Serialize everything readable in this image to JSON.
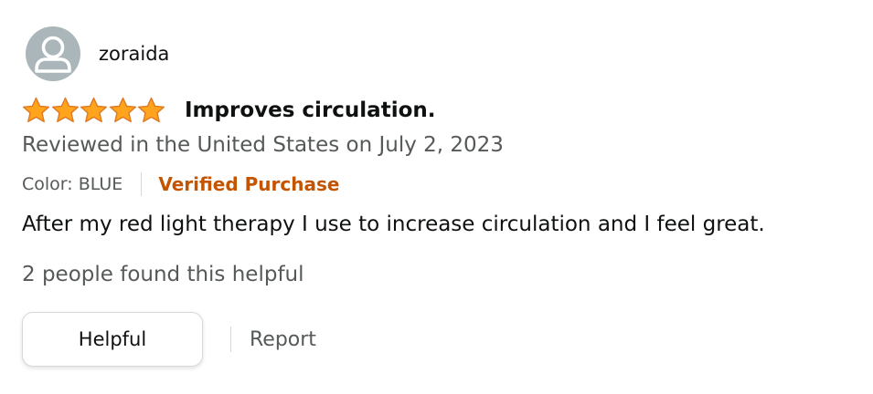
{
  "review": {
    "username": "zoraida",
    "avatar_icon": "default-profile-avatar-icon",
    "rating": 5,
    "rating_max": 5,
    "star_color": "#ffa41c",
    "star_outline_color": "#de7921",
    "title": "Improves circulation.",
    "date_text": "Reviewed in the United States on July 2, 2023",
    "color_variant": "Color: BLUE",
    "verified_label": "Verified Purchase",
    "verified_color": "#c45500",
    "body": "After my red light therapy I use to increase circulation and I feel great.",
    "helpful_count_text": "2 people found this helpful"
  },
  "actions": {
    "helpful_label": "Helpful",
    "report_label": "Report"
  }
}
